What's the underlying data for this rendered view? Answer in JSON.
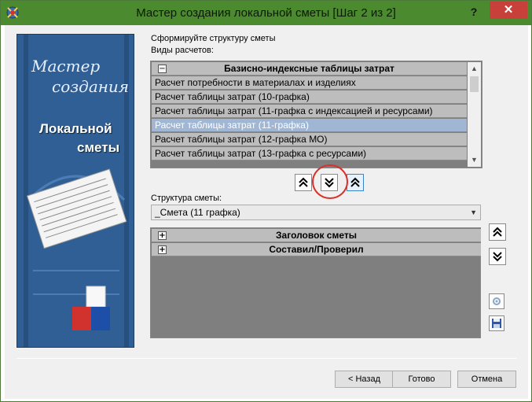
{
  "window": {
    "title": "Мастер создания локальной сметы [Шаг 2 из 2]",
    "help_label": "?",
    "close_label": "✕"
  },
  "banner": {
    "line1": "Мастер",
    "line2": "создания",
    "line3": "Локальной",
    "line4": "сметы"
  },
  "structure_heading": "Сформируйте структуру сметы",
  "calc_types_label": "Виды расчетов:",
  "calc_list": {
    "header": "Базисно-индексные таблицы затрат",
    "header_expander": "−",
    "items": [
      "Расчет потребности в материалах и изделиях",
      "Расчет таблицы затрат (10-графка)",
      "Расчет таблицы затрат (11-графка с индексацией и ресурсами)",
      "Расчет таблицы затрат (11-графка)",
      "Расчет таблицы затрат (12-графка МО)",
      "Расчет таблицы затрат (13-графка с ресурсами)"
    ],
    "selected_index": 3
  },
  "structure_label": "Структура сметы:",
  "structure_combo": {
    "value": "_Смета (11 графка)"
  },
  "tree": {
    "expander": "+",
    "items": [
      "Заголовок сметы",
      "Составил/Проверил"
    ]
  },
  "buttons": {
    "back": "< Назад",
    "finish": "Готово",
    "cancel": "Отмена"
  },
  "colors": {
    "titlebar": "#4c8a2f",
    "close": "#c7403a",
    "selection": "#9fb6d4",
    "highlight_circle": "#d9312b"
  }
}
